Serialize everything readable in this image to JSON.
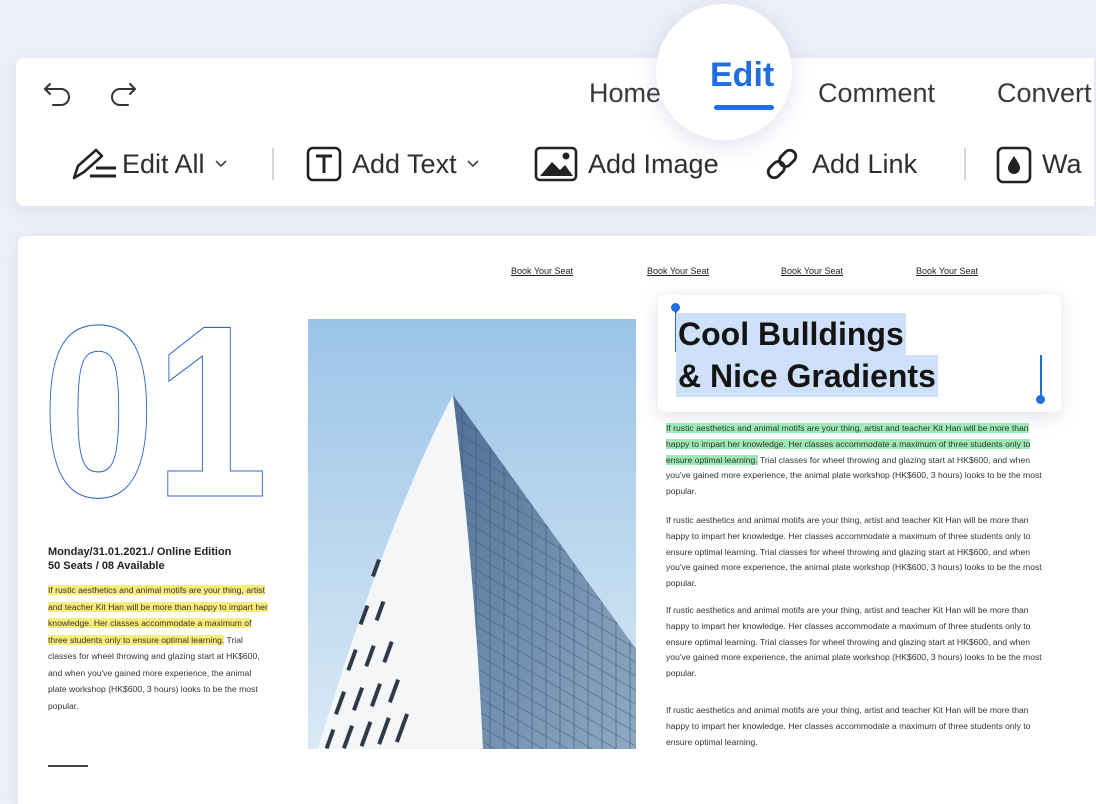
{
  "toolbar": {
    "tabs": {
      "home": "Home",
      "edit": "Edit",
      "comment": "Comment",
      "convert": "Convert"
    },
    "tools": {
      "edit_all": "Edit All",
      "add_text": "Add Text",
      "add_image": "Add Image",
      "add_link": "Add Link",
      "watermark": "Wa"
    }
  },
  "document": {
    "nav_links": [
      "Book Your Seat",
      "Book Your Seat",
      "Book Your Seat",
      "Book Your Seat"
    ],
    "big_number": "01",
    "meta_line1": "Monday/31.01.2021./ Online Edition",
    "meta_line2": "50 Seats / 08 Available",
    "left_highlight": "If rustic aesthetics and animal motifs are your thing, artist and teacher Kit Han will be more than happy to impart her knowledge. Her classes accommodate a maximum of three students only to ensure optimal learning.",
    "left_rest": " Trial classes for wheel throwing and glazing start at HK$600, and when you've gained more experience, the animal plate workshop (HK$600, 3 hours) looks to be the most popular.",
    "heading_line1": "Cool Bulldings",
    "heading_line2": "& Nice Gradients",
    "para1_highlight": "If rustic aesthetics and animal motifs are your thing, artist and teacher Kit Han will be more than happy to impart her knowledge. Her classes accommodate a maximum of three students only to ensure optimal learning.",
    "para1_rest": " Trial classes for wheel throwing and glazing start at HK$600, and when you've gained more experience, the animal plate workshop (HK$600, 3 hours) looks to be the most popular.",
    "para2": "If rustic aesthetics and animal motifs are your thing, artist and teacher Kit Han will be more than happy to impart her knowledge. Her classes accommodate a maximum of three students only to ensure optimal learning. Trial classes for wheel throwing and glazing start at HK$600, and when you've gained more experience, the animal plate workshop (HK$600, 3 hours) looks to be the most popular.",
    "para3": "If rustic aesthetics and animal motifs are your thing, artist and teacher Kit Han will be more than happy to impart her knowledge. Her classes accommodate a maximum of three students only to ensure optimal learning. Trial classes for wheel throwing and glazing start at HK$600, and when you've gained more experience, the animal plate workshop (HK$600, 3 hours) looks to be the most popular.",
    "para4": "If rustic aesthetics and animal motifs are your thing, artist and teacher Kit Han will be more than happy to impart her knowledge. Her classes accommodate a maximum of three students only to ensure optimal learning."
  },
  "colors": {
    "accent": "#1f6fe0",
    "highlight_yellow": "#f8ec7a",
    "highlight_green": "#9eeab7",
    "selection": "#cfe0fb"
  },
  "icons": [
    "undo-icon",
    "redo-icon",
    "edit-all-icon",
    "chevron-down-icon",
    "add-text-icon",
    "add-image-icon",
    "link-icon",
    "watermark-icon"
  ]
}
